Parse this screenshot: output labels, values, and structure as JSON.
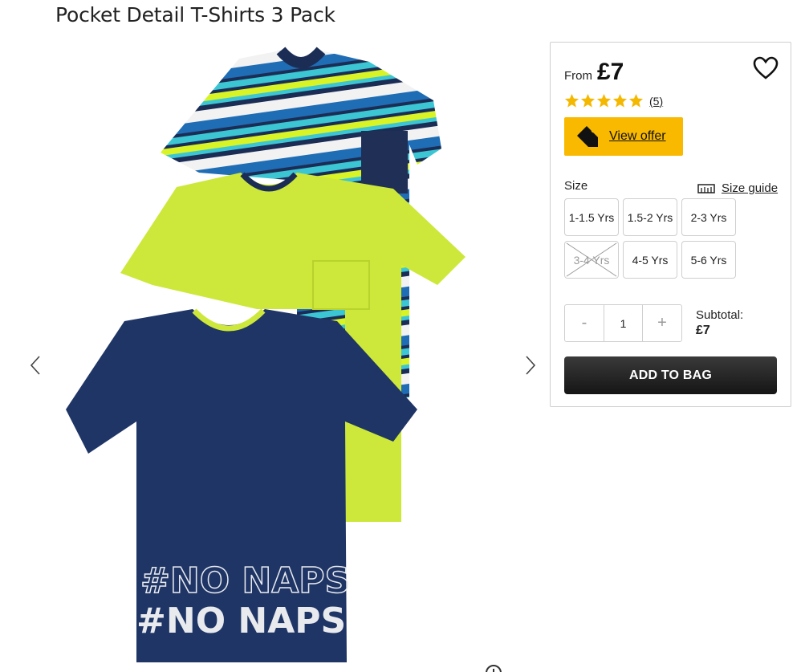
{
  "product": {
    "title": "Pocket Detail T-Shirts 3 Pack",
    "image_alt": "Three children's t-shirts: striped, lime green and navy with #NO NAPS print",
    "print_text": "#NO NAPS"
  },
  "price": {
    "from_label": "From",
    "value": "£7"
  },
  "rating": {
    "stars": 5,
    "count_label": "(5)"
  },
  "offer": {
    "label": "View offer"
  },
  "size": {
    "label": "Size",
    "guide_label": "Size guide",
    "options": [
      {
        "label": "1-1.5 Yrs",
        "available": true
      },
      {
        "label": "1.5-2 Yrs",
        "available": true
      },
      {
        "label": "2-3 Yrs",
        "available": true
      },
      {
        "label": "3-4 Yrs",
        "available": false
      },
      {
        "label": "4-5 Yrs",
        "available": true
      },
      {
        "label": "5-6 Yrs",
        "available": true
      }
    ]
  },
  "quantity": {
    "minus": "-",
    "value": "1",
    "plus": "+"
  },
  "subtotal": {
    "label": "Subtotal:",
    "value": "£7"
  },
  "cart": {
    "add_label": "ADD TO BAG"
  },
  "colors": {
    "offer_bg": "#f9b900",
    "button_bg": "#1f1f1f",
    "star": "#f5b800",
    "navy": "#1f3566",
    "lime": "#cde83a"
  },
  "icons": [
    "chevron-left-icon",
    "chevron-right-icon",
    "heart-icon",
    "star-icon",
    "tag-icon",
    "ruler-icon",
    "zoom-icon"
  ]
}
